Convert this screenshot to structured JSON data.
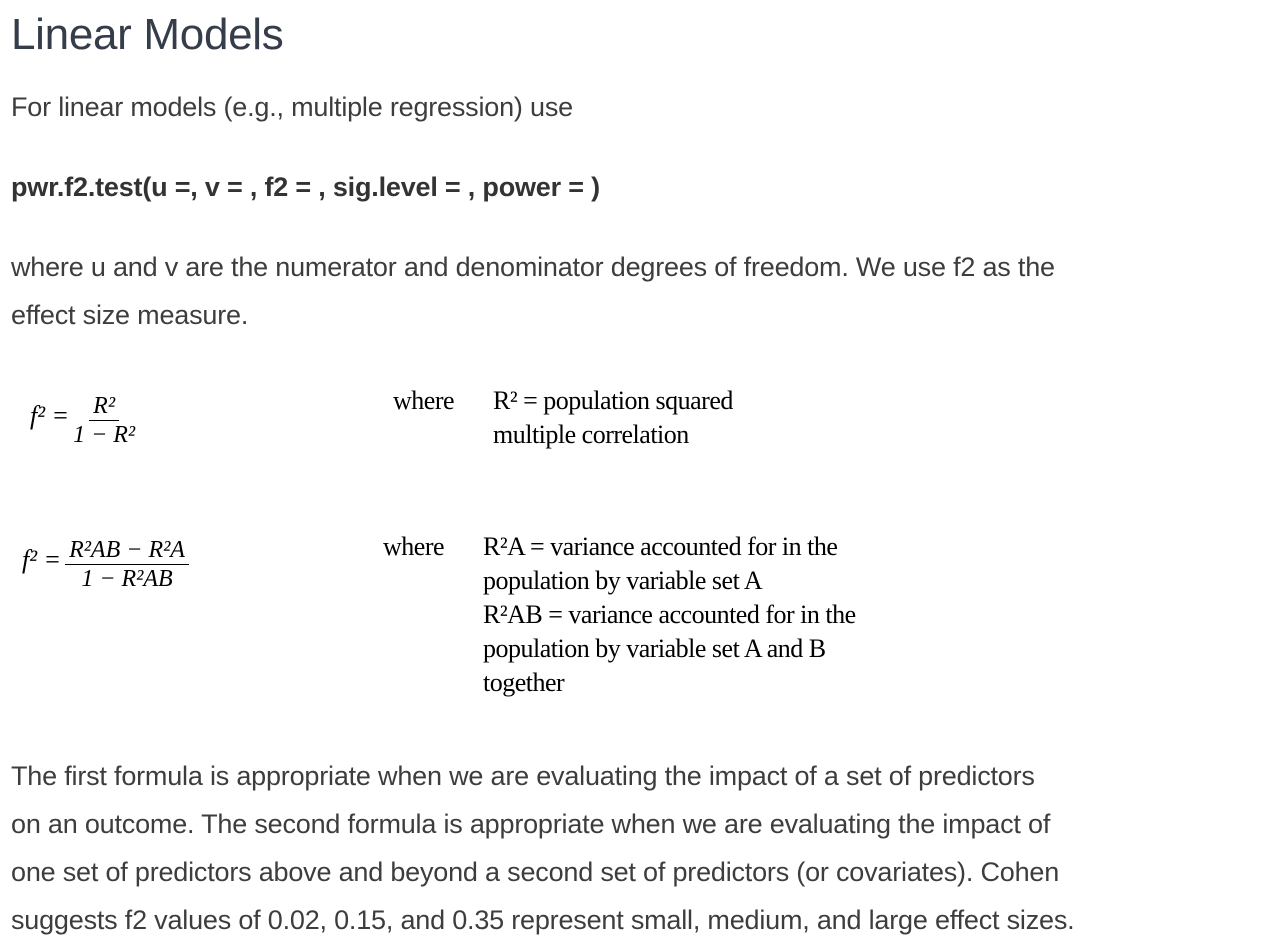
{
  "title": "Linear Models",
  "intro": "For linear models (e.g., multiple regression) use",
  "code": "pwr.f2.test(u =, v = , f2 = , sig.level = , power = )",
  "para1_line1": "where u and v are the numerator and denominator degrees of freedom. We use f2 as the",
  "para1_line2": "effect size measure.",
  "formula1": {
    "lhs": "f² =",
    "numerator": "R²",
    "denominator": "1 − R²",
    "where": "where",
    "desc_line1": "R² = population squared",
    "desc_line2": "multiple correlation"
  },
  "formula2": {
    "lhs": "f² =",
    "numerator": "R²AB − R²A",
    "denominator": "1 − R²AB",
    "where": "where",
    "desc_lines": [
      "R²A = variance accounted for in the",
      "population by variable set A",
      "R²AB = variance accounted for in the",
      "population by variable set A and B",
      "together"
    ]
  },
  "para2_lines": [
    "The first formula is appropriate when we are evaluating the impact of a set of predictors",
    "on an outcome. The second formula is appropriate when we are evaluating the impact of",
    "one set of predictors above and beyond a second set of predictors (or covariates). Cohen",
    "suggests f2 values of 0.02, 0.15, and 0.35 represent small, medium, and large effect sizes."
  ]
}
